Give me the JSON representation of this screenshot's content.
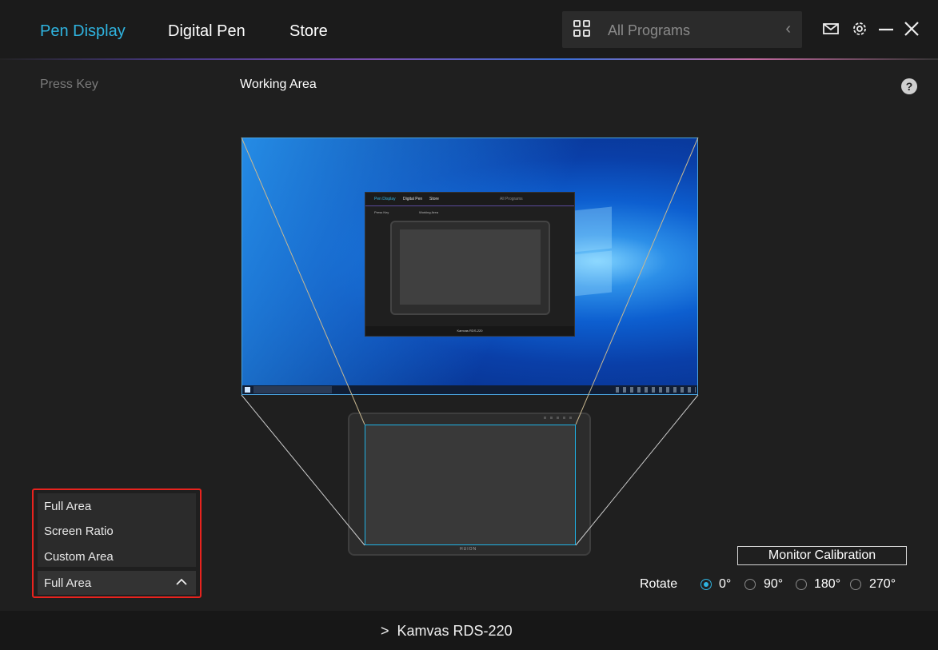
{
  "header": {
    "tabs": [
      {
        "label": "Pen Display",
        "active": true
      },
      {
        "label": "Digital Pen",
        "active": false
      },
      {
        "label": "Store",
        "active": false
      }
    ],
    "programs": {
      "label": "All Programs",
      "icon": "grid-icon"
    },
    "icons": [
      "mail-icon",
      "gear-icon",
      "minimize-icon",
      "close-icon"
    ]
  },
  "subnav": {
    "press_key": "Press Key",
    "working_area": "Working Area",
    "help": "?"
  },
  "preview": {
    "mini_app": {
      "tabs": [
        "Pen Display",
        "Digital Pen",
        "Store"
      ],
      "programs": "All Programs",
      "press_key": "Press Key",
      "working_area": "Working Area",
      "device": "Kamvas RDS-220"
    },
    "brand": "HUION"
  },
  "mapping_dropdown": {
    "options": [
      "Full Area",
      "Screen Ratio",
      "Custom Area"
    ],
    "selected": "Full Area"
  },
  "calibration": {
    "label": "Monitor Calibration"
  },
  "rotate": {
    "label": "Rotate",
    "options": [
      "0°",
      "90°",
      "180°",
      "270°"
    ],
    "selected": "0°"
  },
  "footer": {
    "device": "Kamvas RDS-220",
    "arrow": ">"
  },
  "colors": {
    "accent": "#2fb4e0",
    "highlight": "#e8231e",
    "background": "#1f1f1f"
  }
}
